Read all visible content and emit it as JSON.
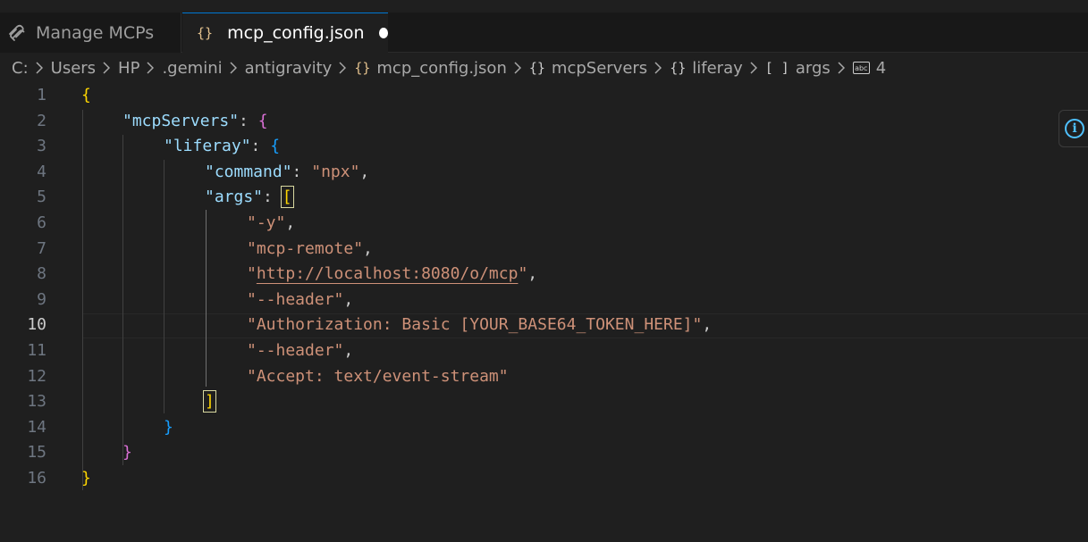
{
  "tabs": [
    {
      "label": "Manage MCPs",
      "icon": "mcp-icon",
      "active": false
    },
    {
      "label": "mcp_config.json",
      "icon": "json-braces-icon",
      "active": true,
      "modified": true
    }
  ],
  "json_icon_text": "{}",
  "object_icon_text": "{}",
  "array_icon_text": "[ ]",
  "string_icon_text": "abc",
  "breadcrumb": [
    "C:",
    "Users",
    "HP",
    ".gemini",
    "antigravity",
    "mcp_config.json",
    "mcpServers",
    "liferay",
    "args",
    "4"
  ],
  "editor": {
    "line_numbers": [
      "1",
      "2",
      "3",
      "4",
      "5",
      "6",
      "7",
      "8",
      "9",
      "10",
      "11",
      "12",
      "13",
      "14",
      "15",
      "16"
    ],
    "active_line": 10,
    "tokens": {
      "open_brace": "{",
      "close_brace": "}",
      "open_bracket": "[",
      "close_bracket": "]",
      "key_mcpServers": "\"mcpServers\"",
      "key_liferay": "\"liferay\"",
      "key_command": "\"command\"",
      "key_args": "\"args\"",
      "colon": ": ",
      "comma": ",",
      "quote": "\"",
      "val_command": "\"npx\"",
      "arg_1": "\"-y\"",
      "arg_2": "\"mcp-remote\"",
      "arg_3_url": "http://localhost:8080/o/mcp",
      "arg_4": "\"--header\"",
      "arg_5": "\"Authorization: Basic [YOUR_BASE64_TOKEN_HERE]\"",
      "arg_6": "\"--header\"",
      "arg_7": "\"Accept: text/event-stream\""
    }
  },
  "colors": {
    "background": "#1f1f1f",
    "key": "#9cdcfe",
    "string": "#ce9178",
    "bracket_level1": "#ffd700",
    "bracket_level2": "#da70d6",
    "bracket_level3": "#179fff",
    "tab_accent": "#0078d4",
    "info_accent": "#4fc1ff"
  },
  "info_button_icon": "info-icon",
  "info_button_text": "i"
}
